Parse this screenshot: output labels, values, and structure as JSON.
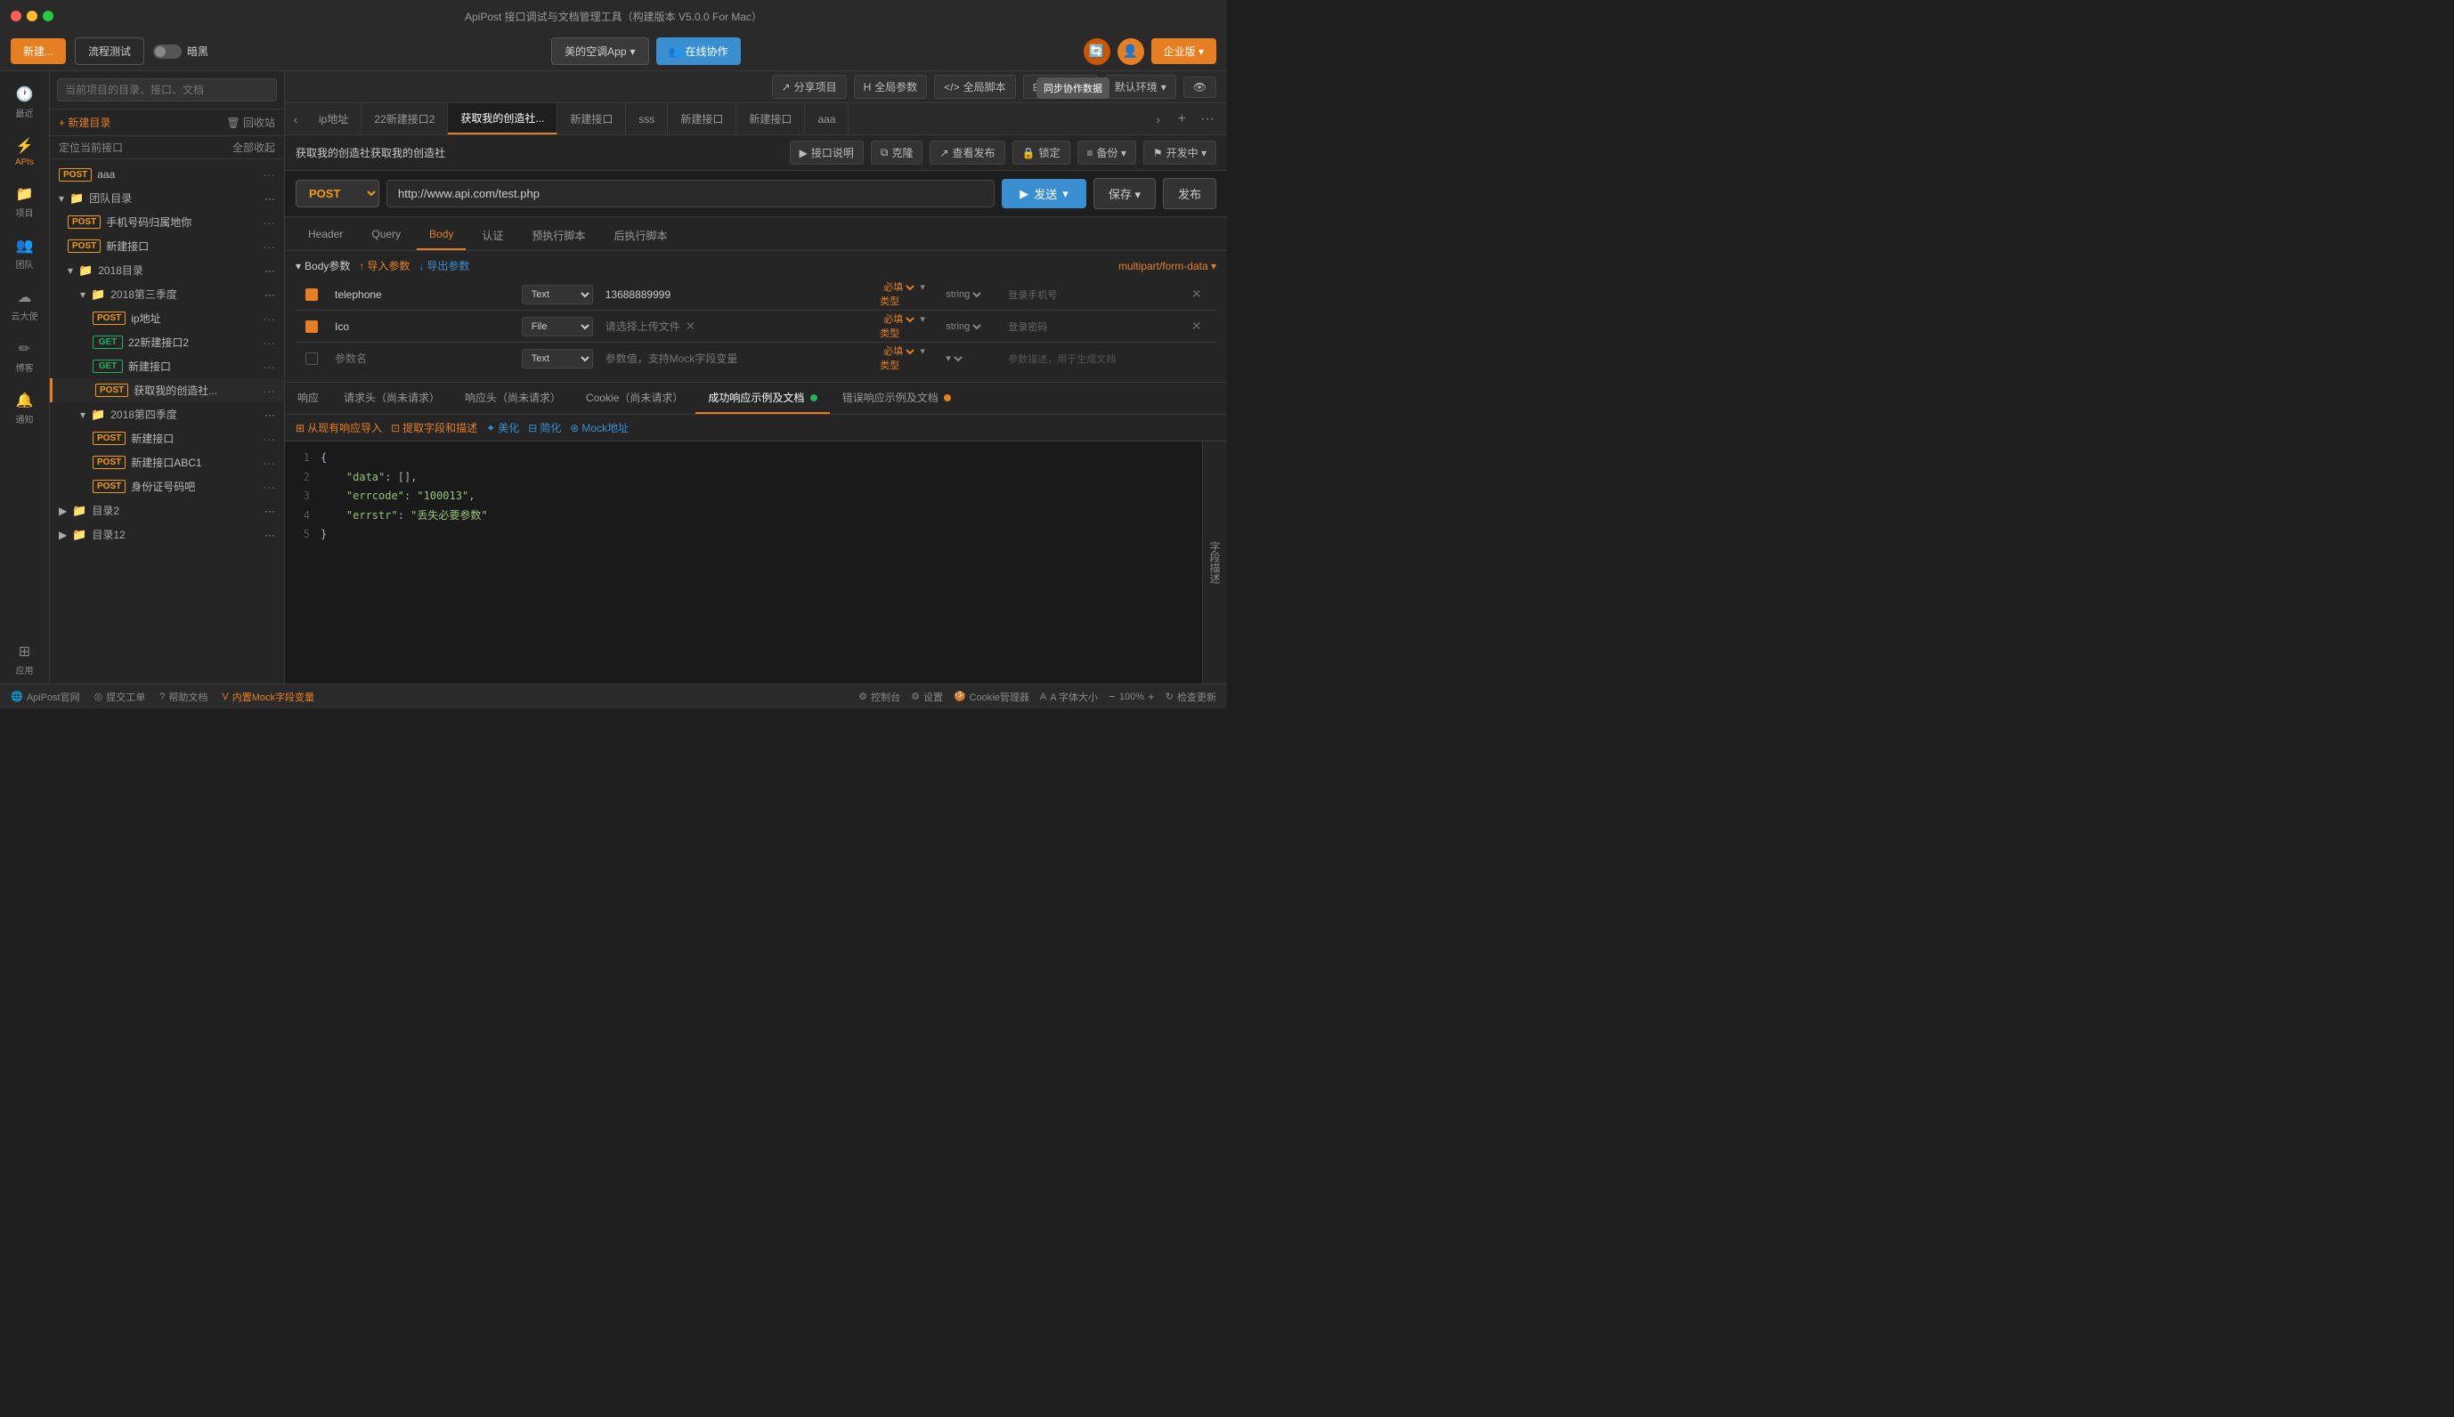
{
  "app": {
    "title": "ApiPost 接口调试与文档管理工具（构建版本 V5.0.0 For Mac）"
  },
  "titlebar": {
    "title": "ApiPost 接口调试与文档管理工具（构建版本 V5.0.0 For Mac）"
  },
  "toolbar": {
    "new_btn": "新建...",
    "workflow_btn": "流程测试",
    "dark_mode": "暗黑",
    "app_btn": "美的空调App",
    "collab_btn": "在线协作",
    "enterprise_btn": "企业版 ▾",
    "tooltip_sync": "同步协作数据"
  },
  "header_actions": {
    "share": "分享项目",
    "global_params": "全局参数",
    "global_script": "全局脚本",
    "params_addon": "参数前置",
    "default_env": "默认环境",
    "visibility": "👁"
  },
  "sidebar_icons": [
    {
      "id": "recent",
      "icon": "🕐",
      "label": "最近",
      "active": false
    },
    {
      "id": "apis",
      "icon": "⚡",
      "label": "APIs",
      "active": true
    },
    {
      "id": "project",
      "icon": "📁",
      "label": "项目",
      "active": false
    },
    {
      "id": "team",
      "icon": "👥",
      "label": "团队",
      "active": false
    },
    {
      "id": "cloud",
      "icon": "☁",
      "label": "云大使",
      "active": false
    },
    {
      "id": "blog",
      "icon": "✏",
      "label": "博客",
      "active": false
    },
    {
      "id": "notify",
      "icon": "🔔",
      "label": "通知",
      "active": false
    },
    {
      "id": "apps",
      "icon": "⊞",
      "label": "应用",
      "active": false
    }
  ],
  "left_panel": {
    "search_placeholder": "当前项目的目录、接口、文档",
    "new_dir_btn": "+ 新建目录",
    "recycle_btn": "🗑 回收站",
    "locate_btn": "定位当前接口",
    "collapse_btn": "全部收起",
    "tree_items": [
      {
        "type": "api",
        "method": "POST",
        "name": "aaa",
        "indent": 0,
        "active": false
      },
      {
        "type": "group",
        "name": "团队目录",
        "indent": 0,
        "expanded": true
      },
      {
        "type": "api",
        "method": "POST",
        "name": "手机号码归属地你",
        "indent": 1,
        "active": false
      },
      {
        "type": "api",
        "method": "POST",
        "name": "新建接口",
        "indent": 1,
        "active": false
      },
      {
        "type": "group",
        "name": "2018目录",
        "indent": 1,
        "expanded": true
      },
      {
        "type": "group",
        "name": "2018第三季度",
        "indent": 2,
        "expanded": true
      },
      {
        "type": "api",
        "method": "POST",
        "name": "ip地址",
        "indent": 3,
        "active": false
      },
      {
        "type": "api",
        "method": "GET",
        "name": "22新建接口2",
        "indent": 3,
        "active": false
      },
      {
        "type": "api",
        "method": "GET",
        "name": "新建接口",
        "indent": 3,
        "active": false
      },
      {
        "type": "api",
        "method": "POST",
        "name": "获取我的创造社...",
        "indent": 3,
        "active": true
      },
      {
        "type": "group",
        "name": "2018第四季度",
        "indent": 2,
        "expanded": true
      },
      {
        "type": "api",
        "method": "POST",
        "name": "新建接口",
        "indent": 3,
        "active": false
      },
      {
        "type": "api",
        "method": "POST",
        "name": "新建接口ABC1",
        "indent": 3,
        "active": false
      },
      {
        "type": "api",
        "method": "POST",
        "name": "身份证号码吧",
        "indent": 3,
        "active": false
      },
      {
        "type": "group",
        "name": "目录2",
        "indent": 0,
        "expanded": false
      },
      {
        "type": "group",
        "name": "目录12",
        "indent": 0,
        "expanded": false
      }
    ]
  },
  "tabs": [
    {
      "id": "tab1",
      "label": "ip地址",
      "active": false
    },
    {
      "id": "tab2",
      "label": "22新建接口2",
      "active": false
    },
    {
      "id": "tab3",
      "label": "获取我的创造社...",
      "active": true
    },
    {
      "id": "tab4",
      "label": "新建接口",
      "active": false
    },
    {
      "id": "tab5",
      "label": "sss",
      "active": false
    },
    {
      "id": "tab6",
      "label": "新建接口",
      "active": false
    },
    {
      "id": "tab7",
      "label": "新建接口",
      "active": false
    },
    {
      "id": "tab8",
      "label": "aaa",
      "active": false
    }
  ],
  "action_bar": {
    "title": "获取我的创造社获取我的创造社",
    "api_desc_btn": "接口说明",
    "clone_btn": "克隆",
    "view_publish_btn": "查看发布",
    "lock_btn": "锁定",
    "backup_btn": "备份 ▾",
    "dev_status_btn": "开发中 ▾"
  },
  "url_bar": {
    "method": "POST",
    "url": "http://www.api.com/test.php",
    "send_btn": "发送",
    "save_btn": "保存",
    "publish_btn": "发布"
  },
  "request_tabs": [
    {
      "id": "header",
      "label": "Header",
      "active": false
    },
    {
      "id": "query",
      "label": "Query",
      "active": false
    },
    {
      "id": "body",
      "label": "Body",
      "active": true
    },
    {
      "id": "auth",
      "label": "认证",
      "active": false
    },
    {
      "id": "pre_script",
      "label": "预执行脚本",
      "active": false
    },
    {
      "id": "post_script",
      "label": "后执行脚本",
      "active": false
    }
  ],
  "body_section": {
    "label": "Body参数",
    "import_btn": "导入参数",
    "export_btn": "导出参数",
    "form_type": "multipart/form-data ▾",
    "params": [
      {
        "checked": true,
        "name": "telephone",
        "type": "Text",
        "value": "13688889999",
        "required": "必填",
        "type2": "类型",
        "desc": "登录手机号"
      },
      {
        "checked": true,
        "name": "Ico",
        "type": "File",
        "value": "请选择上传文件",
        "required": "必填",
        "type2": "类型",
        "desc": "登录密码"
      },
      {
        "checked": false,
        "name": "",
        "type": "Text",
        "value": "",
        "placeholder_name": "参数名",
        "placeholder_value": "参数值，支持Mock字段变量",
        "required": "必填",
        "type2": "类型",
        "desc": "参数描述，用于生成文档",
        "is_placeholder": true
      }
    ]
  },
  "response_tabs": [
    {
      "id": "response",
      "label": "响应",
      "active": false,
      "badge": null
    },
    {
      "id": "req_header",
      "label": "请求头（尚未请求）",
      "active": false,
      "badge": null
    },
    {
      "id": "resp_header",
      "label": "响应头（尚未请求）",
      "active": false,
      "badge": null
    },
    {
      "id": "cookie",
      "label": "Cookie（尚未请求）",
      "active": false,
      "badge": null
    },
    {
      "id": "success_doc",
      "label": "成功响应示例及文档",
      "active": true,
      "badge": "green"
    },
    {
      "id": "error_doc",
      "label": "错误响应示例及文档",
      "active": false,
      "badge": "orange"
    }
  ],
  "response_toolbar": {
    "import_btn": "从现有响应导入",
    "extract_btn": "提取字段和描述",
    "beautify_btn": "美化",
    "simplify_btn": "简化",
    "mock_btn": "Mock地址"
  },
  "code_editor": {
    "lines": [
      {
        "num": 1,
        "text": "{"
      },
      {
        "num": 2,
        "text": "    \"data\": [],"
      },
      {
        "num": 3,
        "text": "    \"errcode\": \"100013\","
      },
      {
        "num": 4,
        "text": "    \"errstr\": \"丢失必要参数\""
      },
      {
        "num": 5,
        "text": "}"
      }
    ]
  },
  "right_side_panel": {
    "text": "字段描述"
  },
  "status_bar": {
    "apipost_site": "ApiPost官网",
    "feedback": "提交工单",
    "help_docs": "帮助文档",
    "mock_vars": "内置Mock字段变量",
    "console": "控制台",
    "settings": "设置",
    "cookie_mgr": "Cookie管理器",
    "font_size": "A 字体大小",
    "zoom": "100%",
    "check_update": "检查更新"
  }
}
